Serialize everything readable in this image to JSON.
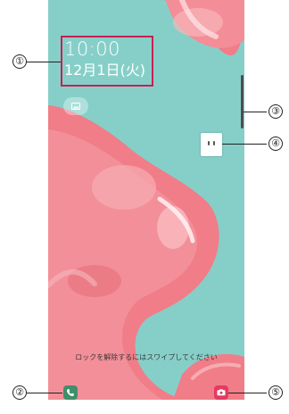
{
  "lock_screen": {
    "time": "10:00",
    "date": "12月1日(火)",
    "unlock_hint": "ロックを解除するにはスワイプしてください",
    "wallpaper_icon": "image-icon",
    "phone_shortcut_icon": "phone-icon",
    "camera_shortcut_icon": "camera-icon"
  },
  "callouts": {
    "c1": "①",
    "c2": "②",
    "c3": "③",
    "c4": "④",
    "c5": "⑤"
  },
  "colors": {
    "background": "#86cfc9",
    "blob": "#f07d88",
    "highlight_box": "#c91f54",
    "phone_button": "#3f8f6a",
    "camera_button": "#e43b61"
  }
}
